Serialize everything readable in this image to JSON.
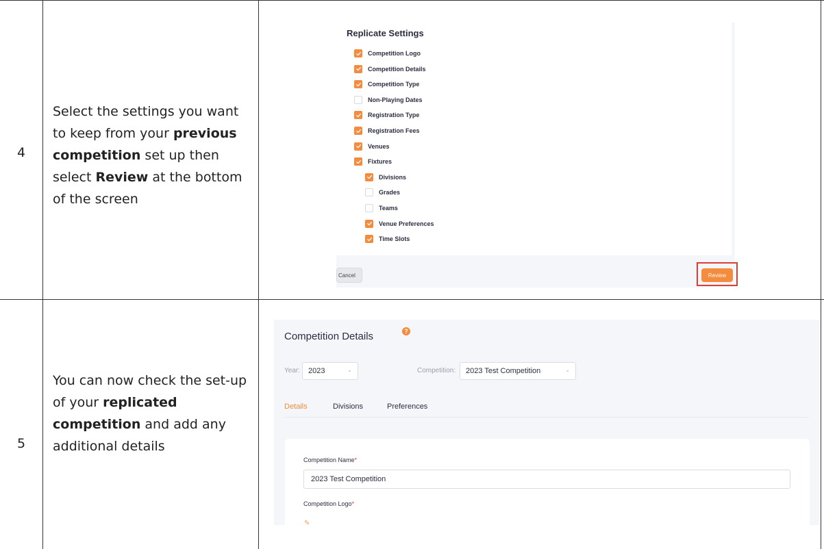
{
  "rows": [
    {
      "step": "4",
      "instruction": {
        "p1": "Select the settings you want to keep from your ",
        "b1": "previous competition",
        "p2": " set up then select ",
        "b2": "Review",
        "p3": " at the bottom of the screen"
      }
    },
    {
      "step": "5",
      "instruction": {
        "p1": "You can now check the set-up of your ",
        "b1": "replicated competition",
        "p2": " and add any additional details"
      }
    }
  ],
  "replicate": {
    "title": "Replicate Settings",
    "items": [
      {
        "label": "Competition Logo",
        "checked": true,
        "indent": false
      },
      {
        "label": "Competition Details",
        "checked": true,
        "indent": false
      },
      {
        "label": "Competition Type",
        "checked": true,
        "indent": false
      },
      {
        "label": "Non-Playing Dates",
        "checked": false,
        "indent": false
      },
      {
        "label": "Registration Type",
        "checked": true,
        "indent": false
      },
      {
        "label": "Registration Fees",
        "checked": true,
        "indent": false
      },
      {
        "label": "Venues",
        "checked": true,
        "indent": false
      },
      {
        "label": "Fixtures",
        "checked": true,
        "indent": false
      },
      {
        "label": "Divisions",
        "checked": true,
        "indent": true
      },
      {
        "label": "Grades",
        "checked": false,
        "indent": true
      },
      {
        "label": "Teams",
        "checked": false,
        "indent": true
      },
      {
        "label": "Venue Preferences",
        "checked": true,
        "indent": true
      },
      {
        "label": "Time Slots",
        "checked": true,
        "indent": true
      }
    ],
    "cancel_label": "Cancel",
    "review_label": "Review",
    "accent_color": "#f58b3c",
    "highlight_color": "#e03c31"
  },
  "details": {
    "title": "Competition Details",
    "help_icon": "?",
    "year_label": "Year:",
    "year_value": "2023",
    "competition_label": "Competition:",
    "competition_value": "2023 Test Competition",
    "tabs": [
      "Details",
      "Divisions",
      "Preferences"
    ],
    "active_tab": "Details",
    "name_label": "Competition Name",
    "name_value": "2023 Test Competition",
    "logo_label": "Competition Logo",
    "required_mark": "*"
  }
}
